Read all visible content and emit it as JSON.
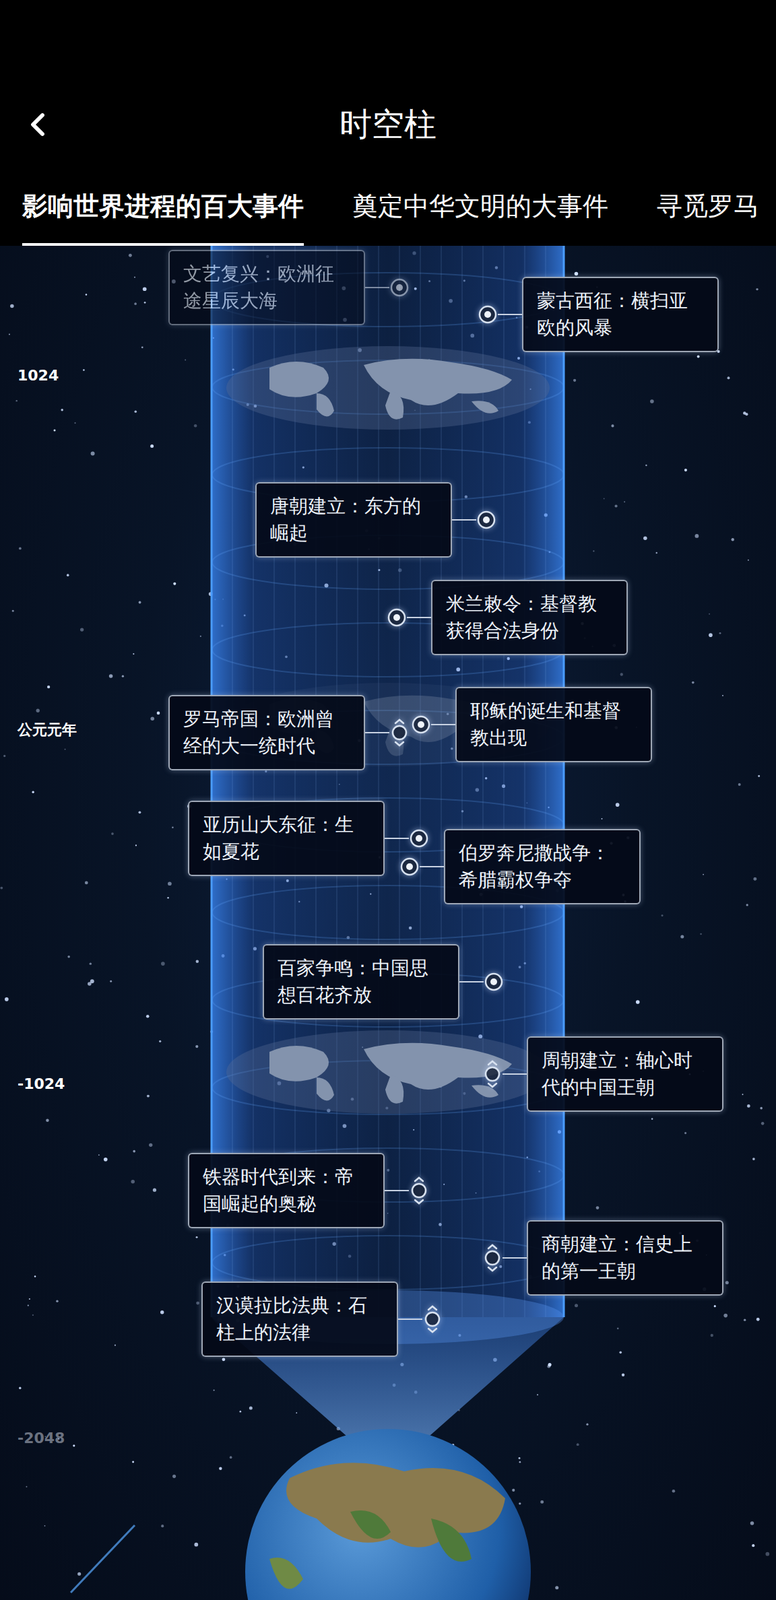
{
  "header": {
    "title": "时空柱"
  },
  "tabs": [
    {
      "label": "影响世界进程的百大事件",
      "selected": true
    },
    {
      "label": "奠定中华文明的大事件",
      "selected": false
    },
    {
      "label": "寻觅罗马",
      "selected": false
    }
  ],
  "axis": [
    {
      "label": "1024",
      "dimmed": false
    },
    {
      "label": "公元元年",
      "dimmed": false
    },
    {
      "label": "-1024",
      "dimmed": false
    },
    {
      "label": "-2048",
      "dimmed": true
    }
  ],
  "events": [
    {
      "title": "文艺复兴：欧洲征途星辰大海",
      "kind": "dot",
      "dimmed": true
    },
    {
      "title": "蒙古西征：横扫亚欧的风暴",
      "kind": "dot",
      "dimmed": false
    },
    {
      "title": "唐朝建立：东方的崛起",
      "kind": "dot",
      "dimmed": false
    },
    {
      "title": "米兰敕令：基督教获得合法身份",
      "kind": "dot",
      "dimmed": false
    },
    {
      "title": "罗马帝国：欧洲曾经的大一统时代",
      "kind": "expand",
      "dimmed": false
    },
    {
      "title": "耶稣的诞生和基督教出现",
      "kind": "dot",
      "dimmed": false
    },
    {
      "title": "亚历山大东征：生如夏花",
      "kind": "dot",
      "dimmed": false
    },
    {
      "title": "伯罗奔尼撒战争：希腊霸权争夺",
      "kind": "dot",
      "dimmed": false
    },
    {
      "title": "百家争鸣：中国思想百花齐放",
      "kind": "dot",
      "dimmed": false
    },
    {
      "title": "周朝建立：轴心时代的中国王朝",
      "kind": "expand",
      "dimmed": false
    },
    {
      "title": "铁器时代到来：帝国崛起的奥秘",
      "kind": "expand",
      "dimmed": false
    },
    {
      "title": "商朝建立：信史上的第一王朝",
      "kind": "expand",
      "dimmed": false
    },
    {
      "title": "汉谟拉比法典：石柱上的法律",
      "kind": "expand",
      "dimmed": false
    }
  ]
}
